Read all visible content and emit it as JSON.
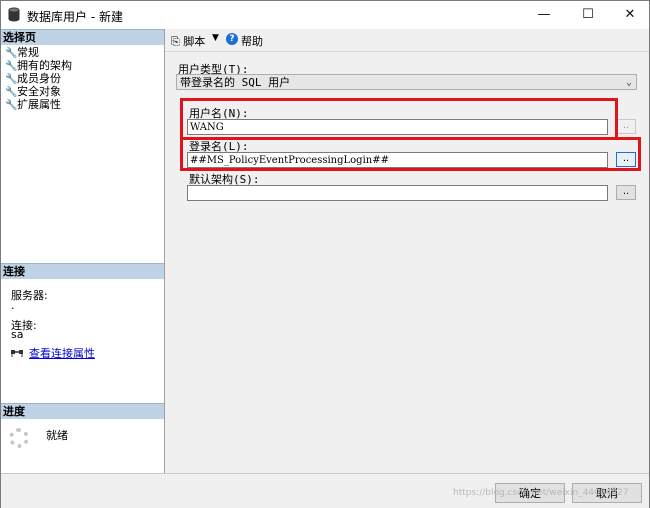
{
  "window": {
    "title": "数据库用户 - 新建",
    "controls": {
      "minimize": "—",
      "maximize": "☐",
      "close": "✕"
    }
  },
  "sidebar": {
    "select_page_header": "选择页",
    "items": [
      {
        "label": "常规"
      },
      {
        "label": "拥有的架构"
      },
      {
        "label": "成员身份"
      },
      {
        "label": "安全对象"
      },
      {
        "label": "扩展属性"
      }
    ],
    "connection_header": "连接",
    "server_label": "服务器:",
    "server_value": ".",
    "connection_label": "连接:",
    "connection_value": "sa",
    "view_connection_link": "查看连接属性",
    "progress_header": "进度",
    "progress_status": "就绪"
  },
  "toolbar": {
    "script_label": "脚本",
    "help_label": "帮助"
  },
  "form": {
    "user_type_label": "用户类型(T):",
    "user_type_value": "带登录名的 SQL 用户",
    "user_name_label": "用户名(N):",
    "user_name_value": "WANG",
    "login_name_label": "登录名(L):",
    "login_name_value": "##MS_PolicyEventProcessingLogin##",
    "default_schema_label": "默认架构(S):",
    "default_schema_value": "",
    "browse_label": ".."
  },
  "footer": {
    "ok_label": "确定",
    "cancel_label": "取消",
    "watermark": "https://blog.csdn.net/weixin_44064427"
  },
  "annotation_color": "#e0151b"
}
